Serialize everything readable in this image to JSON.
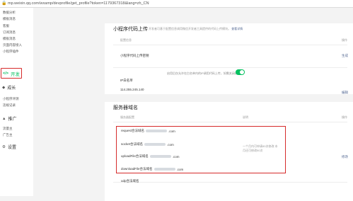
{
  "browser": {
    "url": "mp.weixin.qq.com/wxamp/devprofile/get_profile?token=1179367318&lang=zh_CN"
  },
  "sidebar": {
    "top_items": [
      "数据分析",
      "模板消息",
      "客服",
      "订阅消息",
      "模板消息",
      "页面内容接入",
      "小程序插件"
    ],
    "dev_label": "开发",
    "growth_label": "成长",
    "growth_items": [
      "小程序评测",
      "违规记录"
    ],
    "promo_label": "推广",
    "promo_items": [
      "流量主",
      "广告主"
    ],
    "settings_label": "设置"
  },
  "section_code": {
    "title": "小程序代码上传",
    "desc": "开发者可基于配置信息调用微信开发者工具提供的代码上传模块。",
    "desc_link": "查看详情",
    "col_config": "配置信息",
    "col_action": "操作",
    "row1_label": "小程序代码上传密钥",
    "row1_action": "生成",
    "row2_label": "IP白名单",
    "row2_value": "114.255.245.140",
    "toggle_label": "启用后仅允许在白名单内的IP调用代码上传，如需关闭请",
    "toggle_on": true,
    "row2_action": "编辑"
  },
  "section_domain": {
    "title": "服务器域名",
    "col_config": "服务器配置",
    "col_note": "说明",
    "col_action": "操作",
    "rows": [
      {
        "label": "request合法域名",
        "suffix": ".com"
      },
      {
        "label": "socket合法域名",
        "suffix": ".com"
      },
      {
        "label": "uploadFile合法域名",
        "suffix": ".com"
      },
      {
        "label": "downloadFile合法域名",
        "suffix": ".com"
      }
    ],
    "note": "一个月内可申请50次修改 本月还可修改50次",
    "action": "修改",
    "udp_label": "udp合法域名"
  },
  "colors": {
    "accent": "#07c160",
    "highlight": "#d62b2b",
    "link": "#576b95"
  }
}
